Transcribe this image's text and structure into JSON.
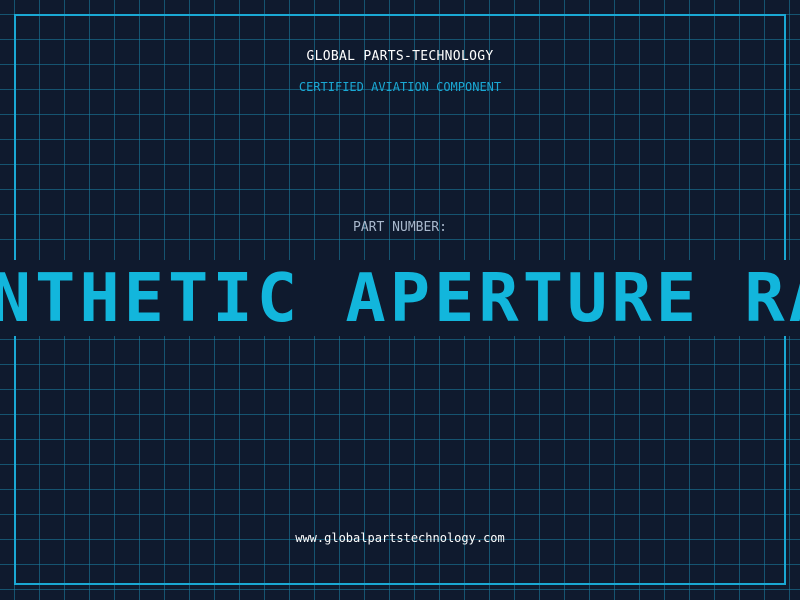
{
  "header": {
    "company_name": "GLOBAL PARTS-TECHNOLOGY",
    "subtitle": "CERTIFIED AVIATION COMPONENT"
  },
  "part": {
    "label": "PART NUMBER:",
    "value": "SYNTHETIC APERTURE RADAR"
  },
  "footer": {
    "website": "www.globalpartstechnology.com"
  },
  "colors": {
    "background": "#0f1a2e",
    "accent": "#1aa8d4",
    "part_number": "#12b6dc",
    "label": "#a9b8cc",
    "text": "#ffffff"
  }
}
